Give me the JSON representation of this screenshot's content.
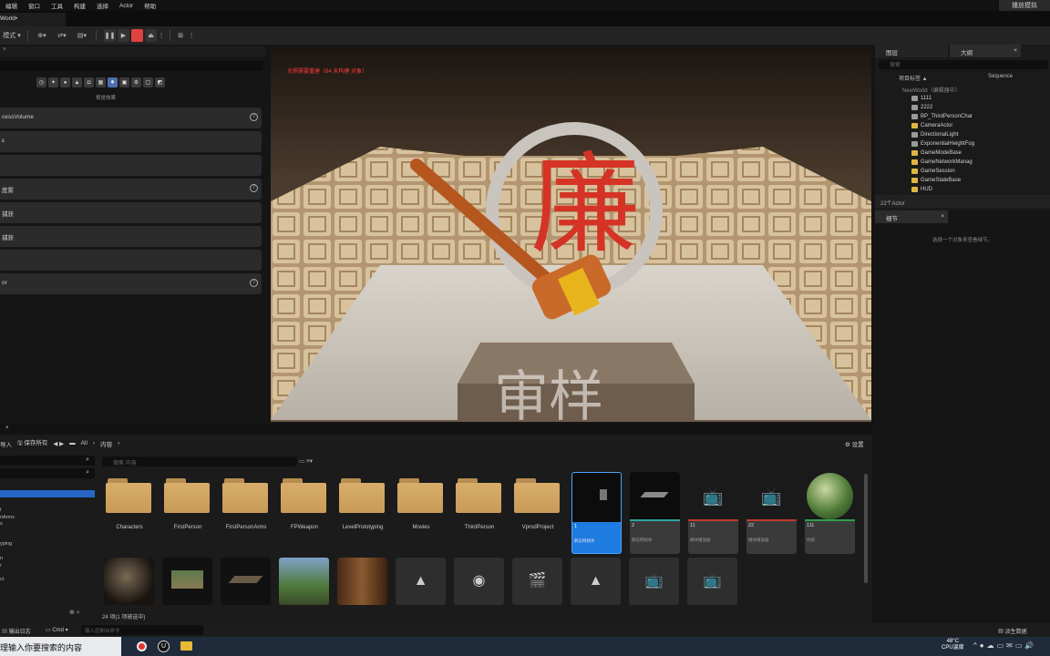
{
  "menubar": {
    "items": [
      "编辑",
      "窗口",
      "工具",
      "构建",
      "选择",
      "Actor",
      "帮助"
    ],
    "right_button": "播放模拟"
  },
  "tab": {
    "label": "World•"
  },
  "toolbar": {
    "mode_label": "模式"
  },
  "left_panel": {
    "caption": "视觉效果",
    "rows": [
      {
        "label": "cessVolume",
        "help": true
      },
      {
        "label": "",
        "help": false
      },
      {
        "label": "",
        "help": false
      },
      {
        "label": "度雾",
        "help": true
      },
      {
        "label": "捕获",
        "help": false
      },
      {
        "label": "捕获",
        "help": false
      },
      {
        "label": "",
        "help": false
      },
      {
        "label": "or",
        "help": true
      }
    ]
  },
  "viewport": {
    "warning": "光照需要重建（64 未构建 对象）"
  },
  "outliner": {
    "tab_layers": "图层",
    "tab_outliner": "大纲",
    "search_placeholder": "搜索",
    "col_label": "项目标签 ▲",
    "col_sequence": "Sequence",
    "world": "NewWorld（编辑器中）",
    "items": [
      {
        "name": "1111",
        "yellow": false
      },
      {
        "name": "2222",
        "yellow": false
      },
      {
        "name": "BP_ThirdPersonChar",
        "yellow": false
      },
      {
        "name": "CameraActor",
        "yellow": true
      },
      {
        "name": "DirectionalLight",
        "yellow": false
      },
      {
        "name": "ExponentialHeightFog",
        "yellow": false
      },
      {
        "name": "GameModeBase",
        "yellow": true
      },
      {
        "name": "GameNetworkManag",
        "yellow": true
      },
      {
        "name": "GameSession",
        "yellow": true
      },
      {
        "name": "GameStateBase",
        "yellow": true
      },
      {
        "name": "HUD",
        "yellow": true
      }
    ],
    "count": "22个Actor"
  },
  "details": {
    "tab": "细节",
    "empty_text": "选择一个对象来查看细节。"
  },
  "content_browser": {
    "import_label": "导入",
    "save_all_label": "保存所有",
    "path_all": "All",
    "path_content": "内容",
    "settings_label": "设置",
    "search_placeholder": "搜索 内容",
    "folders": [
      "Characters",
      "FirstPerson",
      "FirstPersonArms",
      "FPWeapon",
      "LevelPrototyping",
      "Movies",
      "ThirdPerson",
      "VprodProject"
    ],
    "assets": [
      {
        "name": "1",
        "type": "静态网格体",
        "color": "#1e7be0"
      },
      {
        "name": "2",
        "type": "静态网格体",
        "color": "#2aa7a0"
      },
      {
        "name": "11",
        "type": "媒体播放器",
        "color": "#c0392b"
      },
      {
        "name": "22",
        "type": "媒体播放器",
        "color": "#c0392b"
      },
      {
        "name": "111",
        "type": "材质",
        "color": "#2f9e4e"
      }
    ],
    "side_items": [
      "t",
      "nArms",
      "s",
      "yping",
      "n",
      "r",
      "ct"
    ],
    "status": "24 项(1 项被选中)"
  },
  "statusbar": {
    "output_log": "输出日志",
    "cmd": "Cmd",
    "cmd_placeholder": "输入控制台命令",
    "derived_data": "派生数据"
  },
  "taskbar": {
    "search_text": "理输入你要搜索的内容",
    "temp": "48°C",
    "temp_label": "CPU温度"
  }
}
